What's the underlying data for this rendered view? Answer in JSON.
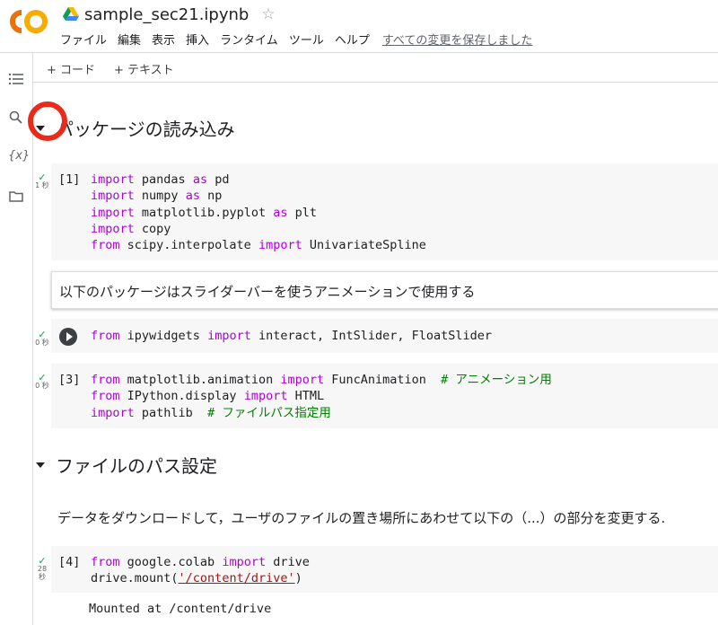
{
  "header": {
    "title": "sample_sec21.ipynb",
    "star_icon": "star-outline-icon",
    "menu": [
      "ファイル",
      "編集",
      "表示",
      "挿入",
      "ランタイム",
      "ツール",
      "ヘルプ"
    ],
    "saved_status": "すべての変更を保存しました"
  },
  "toolbar": {
    "add_code": "+ コード",
    "add_text": "+ テキスト"
  },
  "sidebar": {
    "icons": [
      "toc-icon",
      "search-icon",
      "variables-icon",
      "folder-icon"
    ],
    "variables_label": "{x}"
  },
  "sections": [
    {
      "title": "パッケージの読み込み"
    },
    {
      "title": "ファイルのパス設定"
    }
  ],
  "cells": {
    "c1": {
      "exec": "[1]",
      "status": "1 秒"
    },
    "text1": "以下のパッケージはスライダーバーを使うアニメーションで使用する",
    "c2": {
      "status": "0 秒"
    },
    "c3": {
      "exec": "[3]",
      "status": "0 秒"
    },
    "para": "データをダウンロードして，ユーザのファイルの置き場所にあわせて以下の（...）の部分を変更する.",
    "c4": {
      "exec": "[4]",
      "status_top": "28",
      "status_bottom": "秒",
      "output": "Mounted at /content/drive"
    }
  },
  "code": {
    "c1": [
      [
        [
          "kw",
          "import"
        ],
        [
          "t",
          " pandas "
        ],
        [
          "kw",
          "as"
        ],
        [
          "t",
          " pd"
        ]
      ],
      [
        [
          "kw",
          "import"
        ],
        [
          "t",
          " numpy "
        ],
        [
          "kw",
          "as"
        ],
        [
          "t",
          " np"
        ]
      ],
      [
        [
          "kw",
          "import"
        ],
        [
          "t",
          " matplotlib.pyplot "
        ],
        [
          "kw",
          "as"
        ],
        [
          "t",
          " plt"
        ]
      ],
      [
        [
          "kw",
          "import"
        ],
        [
          "t",
          " copy"
        ]
      ],
      [
        [
          "kw",
          "from"
        ],
        [
          "t",
          " scipy.interpolate "
        ],
        [
          "kw",
          "import"
        ],
        [
          "t",
          " UnivariateSpline"
        ]
      ]
    ],
    "c2": [
      [
        [
          "kw",
          "from"
        ],
        [
          "t",
          " ipywidgets "
        ],
        [
          "kw",
          "import"
        ],
        [
          "t",
          " interact, IntSlider, FloatSlider"
        ]
      ]
    ],
    "c3": [
      [
        [
          "kw",
          "from"
        ],
        [
          "t",
          " matplotlib.animation "
        ],
        [
          "kw",
          "import"
        ],
        [
          "t",
          " FuncAnimation  "
        ],
        [
          "cm",
          "# アニメーション用"
        ]
      ],
      [
        [
          "kw",
          "from"
        ],
        [
          "t",
          " IPython.display "
        ],
        [
          "kw",
          "import"
        ],
        [
          "t",
          " HTML"
        ]
      ],
      [
        [
          "kw",
          "import"
        ],
        [
          "t",
          " pathlib  "
        ],
        [
          "cm",
          "# ファイルパス指定用"
        ]
      ]
    ],
    "c4": [
      [
        [
          "kw",
          "from"
        ],
        [
          "t",
          " google.colab "
        ],
        [
          "kw",
          "import"
        ],
        [
          "t",
          " drive"
        ]
      ],
      [
        [
          "t",
          "drive.mount("
        ],
        [
          "str",
          "'/content/drive'"
        ],
        [
          "t",
          ")"
        ]
      ]
    ]
  },
  "colors": {
    "keyword": "#af00db",
    "comment": "#008000",
    "string": "#a31515",
    "highlight_circle": "#ea2a1a",
    "logo_orange": "#f9ab00",
    "logo_dark": "#e8710a"
  }
}
